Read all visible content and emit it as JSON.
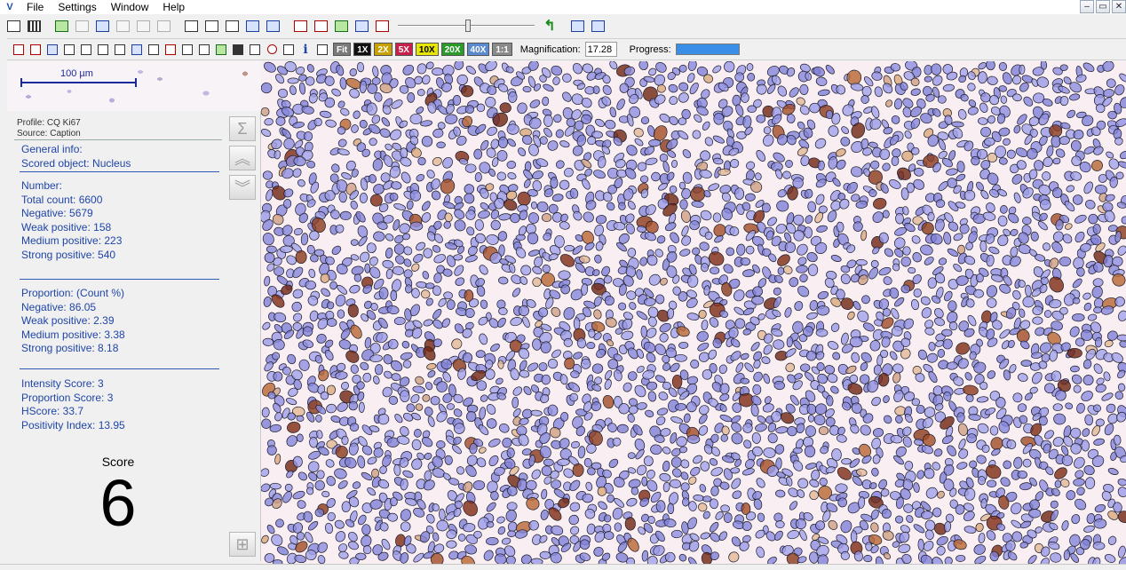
{
  "menu": {
    "app_icon": "V",
    "items": [
      "File",
      "Settings",
      "Window",
      "Help"
    ]
  },
  "window_controls": {
    "minimize": "–",
    "restore": "▭",
    "close": "✕"
  },
  "toolbar2": {
    "magnify_buttons": [
      {
        "label": "Fit",
        "bg": "#7a7a7a",
        "fg": "#ffffff"
      },
      {
        "label": "1X",
        "bg": "#111111",
        "fg": "#ffffff"
      },
      {
        "label": "2X",
        "bg": "#c8a000",
        "fg": "#ffffff"
      },
      {
        "label": "5X",
        "bg": "#c8204a",
        "fg": "#ffffff"
      },
      {
        "label": "10X",
        "bg": "#e6e600",
        "fg": "#000000"
      },
      {
        "label": "20X",
        "bg": "#2a9a2a",
        "fg": "#ffffff"
      },
      {
        "label": "40X",
        "bg": "#5a8ad0",
        "fg": "#ffffff"
      },
      {
        "label": "1:1",
        "bg": "#8a8a8a",
        "fg": "#ffffff"
      }
    ],
    "magnification_label": "Magnification:",
    "magnification_value": "17.28",
    "progress_label": "Progress:",
    "progress_fraction": 1.0
  },
  "scale": {
    "label": "100 µm"
  },
  "profile": {
    "line1": "Profile: CQ Ki67",
    "line2": "Source: Caption"
  },
  "general": {
    "head": "General info:",
    "scored_object": "Scored object: Nucleus"
  },
  "number": {
    "head": "Number:",
    "total": "Total count: 6600",
    "negative": "Negative: 5679",
    "weak": "Weak positive: 158",
    "medium": "Medium positive: 223",
    "strong": "Strong positive: 540"
  },
  "proportion": {
    "head": "Proportion: (Count %)",
    "negative": "Negative: 86.05",
    "weak": "Weak positive: 2.39",
    "medium": "Medium positive: 3.38",
    "strong": "Strong positive: 8.18"
  },
  "scores": {
    "intensity": "Intensity Score: 3",
    "proportion": "Proportion Score: 3",
    "hscore": "HScore: 33.7",
    "positivity": "Positivity Index: 13.95"
  },
  "score": {
    "label": "Score",
    "value": "6"
  },
  "side_buttons": [
    {
      "name": "sum-icon",
      "glyph": "Σ"
    },
    {
      "name": "chevron-double-up-icon",
      "glyph": "︽"
    },
    {
      "name": "chevron-double-down-icon",
      "glyph": "︾"
    },
    {
      "name": "hierarchy-icon",
      "glyph": "⊞"
    }
  ],
  "colors": {
    "accent": "#1f45a8",
    "hematoxylin": "#7f7fd1",
    "dab": "#8b3a1a"
  }
}
